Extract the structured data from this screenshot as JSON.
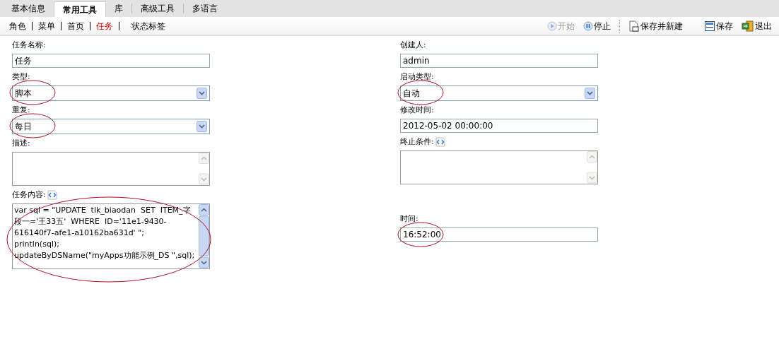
{
  "tabs": [
    {
      "label": "基本信息",
      "selected": false
    },
    {
      "label": "常用工具",
      "selected": true
    },
    {
      "label": "库",
      "selected": false
    },
    {
      "label": "高级工具",
      "selected": false
    },
    {
      "label": "多语言",
      "selected": false
    }
  ],
  "subnav": [
    {
      "label": "角色",
      "selected": false
    },
    {
      "label": "菜单",
      "selected": false
    },
    {
      "label": "首页",
      "selected": false
    },
    {
      "label": "任务",
      "selected": true
    },
    {
      "label": "状态标签",
      "selected": false
    }
  ],
  "toolbar": [
    {
      "kind": "play",
      "label": "开始",
      "disabled": true
    },
    {
      "kind": "pause",
      "label": "停止",
      "disabled": false
    },
    {
      "kind": "separator"
    },
    {
      "kind": "new",
      "label": "保存并新建",
      "disabled": false
    },
    {
      "kind": "save",
      "label": "保存",
      "disabled": false
    },
    {
      "kind": "exit",
      "label": "退出",
      "disabled": false
    }
  ],
  "left_fields": [
    {
      "kind": "text",
      "label": "任务名称:",
      "value": "任务"
    },
    {
      "kind": "select",
      "label": "类型:",
      "value": "脚本",
      "circled": true
    },
    {
      "kind": "select",
      "label": "重复:",
      "value": "每日",
      "circled": true
    },
    {
      "kind": "textarea",
      "label": "描述:"
    },
    {
      "kind": "textarea",
      "label": "任务内容:",
      "value": "var sql = \"UPDATE  tlk_biaodan  SET  ITEM_字段一='王33五'  WHERE  ID='11e1-9430-616140f7-afe1-a10162ba631d' \";\nprintln(sql);\nupdateByDSName(\"myApps功能示例_DS \",sql);",
      "circled": true,
      "script_icon": true
    }
  ],
  "right_fields": [
    {
      "kind": "text",
      "label": "创建人:",
      "value": "admin"
    },
    {
      "kind": "select",
      "label": "启动类型:",
      "value": "自动",
      "circled": true
    },
    {
      "kind": "text",
      "label": "修改时间:",
      "value": "2012-05-02 00:00:00"
    },
    {
      "kind": "textarea",
      "label": "终止条件:",
      "script_icon": true
    },
    {
      "kind": "text",
      "label": "时间:",
      "value": "16:52:00",
      "circled": true,
      "gap": true
    }
  ]
}
